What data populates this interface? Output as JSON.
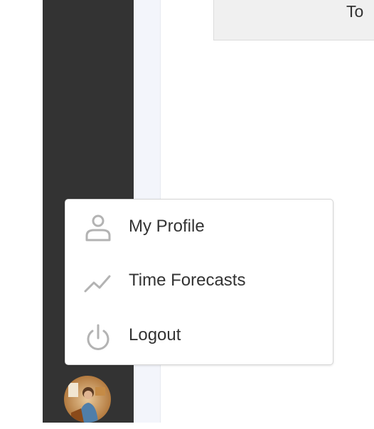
{
  "top_card": {
    "text": "To"
  },
  "user_menu": {
    "items": [
      {
        "label": "My Profile",
        "icon": "user-icon"
      },
      {
        "label": "Time Forecasts",
        "icon": "trend-line-icon"
      },
      {
        "label": "Logout",
        "icon": "power-icon"
      }
    ]
  },
  "colors": {
    "sidebar": "#333333",
    "panel_strip": "#f3f5fb",
    "text": "#333333",
    "icon": "#b3b3b3",
    "menu_border": "#d6d6d6"
  }
}
